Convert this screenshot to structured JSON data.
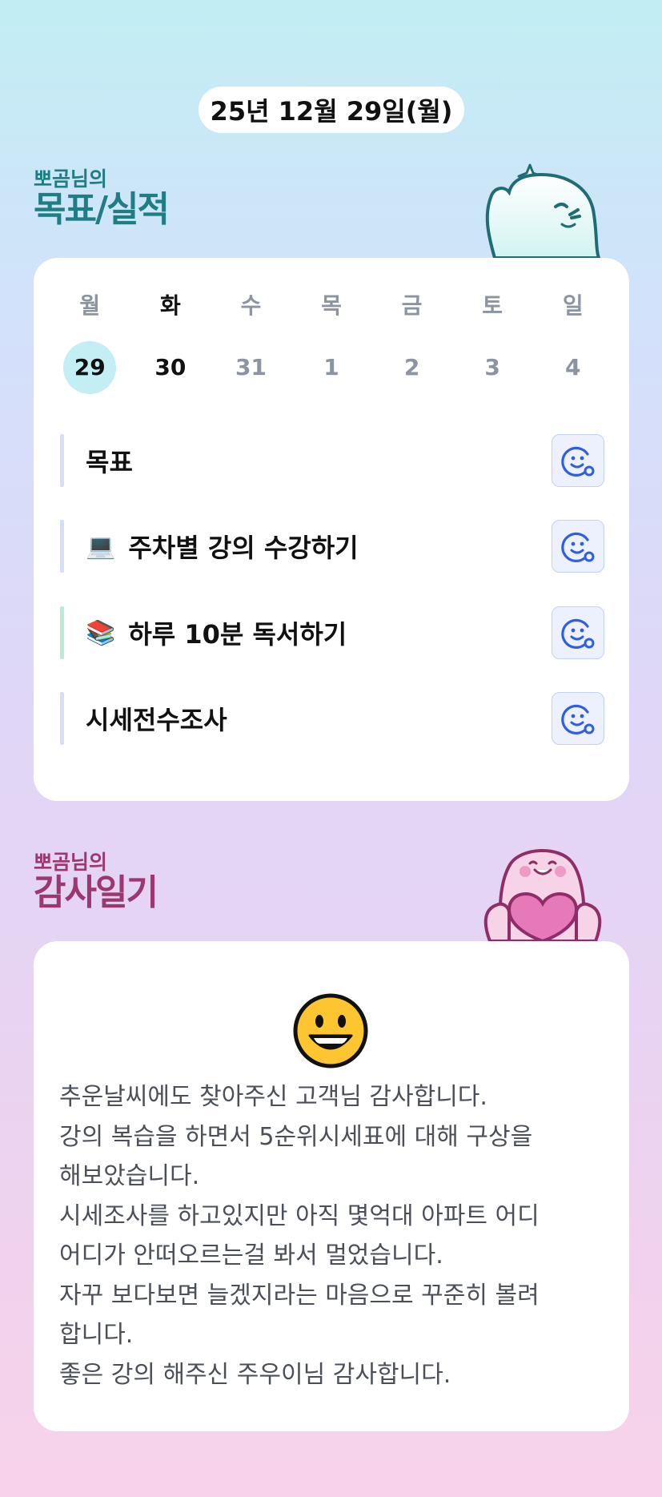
{
  "date_label": "25년 12월 29일(월)",
  "goals_section": {
    "subtitle": "뽀곰님의",
    "title": "목표/실적"
  },
  "week": [
    {
      "weekday": "월",
      "date": "29",
      "state": "selected"
    },
    {
      "weekday": "화",
      "date": "30",
      "state": "active"
    },
    {
      "weekday": "수",
      "date": "31",
      "state": "muted"
    },
    {
      "weekday": "목",
      "date": "1",
      "state": "muted"
    },
    {
      "weekday": "금",
      "date": "2",
      "state": "muted"
    },
    {
      "weekday": "토",
      "date": "3",
      "state": "muted"
    },
    {
      "weekday": "일",
      "date": "4",
      "state": "muted"
    }
  ],
  "goals": [
    {
      "icon": "",
      "label": "목표"
    },
    {
      "icon": "💻",
      "label": "주차별 강의 수강하기"
    },
    {
      "icon": "📚",
      "label": "하루 10분 독서하기"
    },
    {
      "icon": "",
      "label": "시세전수조사"
    }
  ],
  "gratitude_section": {
    "subtitle": "뽀곰님의",
    "title": "감사일기"
  },
  "diary": {
    "mood_icon": "grinning-face-icon",
    "lines": [
      "추운날씨에도 찾아주신 고객님 감사합니다.",
      "강의 복습을 하면서 5순위시세표에 대해 구상을",
      "해보았습니다.",
      "시세조사를 하고있지만 아직 몇억대 아파트 어디",
      "어디가 안떠오르는걸 봐서 멀었습니다.",
      "자꾸 보다보면 늘겠지라는 마음으로 꾸준히 볼려",
      "합니다.",
      "좋은 강의 해주신 주우이님 감사합니다."
    ]
  },
  "colors": {
    "goals_heading": "#1f7d84",
    "gratitude_heading": "#9b3870",
    "selected_date_bg": "#c3eef4",
    "reaction_icon": "#2f5ee0"
  }
}
